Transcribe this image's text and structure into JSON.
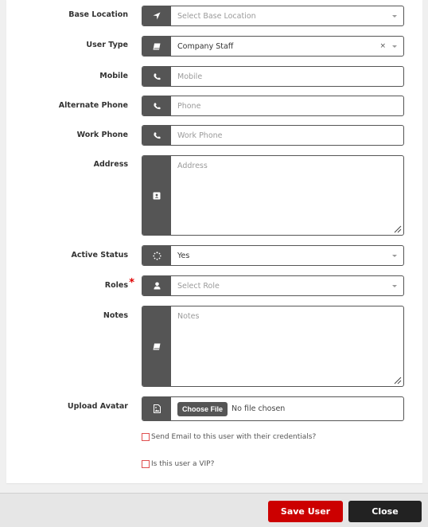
{
  "form": {
    "fields": [
      {
        "label": "Base Location",
        "type": "select",
        "icon": "location-arrow-icon",
        "placeholder": "Select Base Location",
        "value": ""
      },
      {
        "label": "User Type",
        "type": "select",
        "icon": "book-icon",
        "placeholder": "",
        "value": "Company Staff",
        "clearable": true,
        "clear_glyph": "×"
      },
      {
        "label": "Mobile",
        "type": "text",
        "icon": "phone-icon",
        "placeholder": "Mobile",
        "value": ""
      },
      {
        "label": "Alternate Phone",
        "type": "text",
        "icon": "phone-icon",
        "placeholder": "Phone",
        "value": ""
      },
      {
        "label": "Work Phone",
        "type": "text",
        "icon": "phone-icon",
        "placeholder": "Work Phone",
        "value": ""
      },
      {
        "label": "Address",
        "type": "textarea",
        "icon": "address-card-icon",
        "placeholder": "Address",
        "value": ""
      },
      {
        "label": "Active Status",
        "type": "select",
        "icon": "spinner-icon",
        "placeholder": "",
        "value": "Yes"
      },
      {
        "label": "Roles",
        "type": "select",
        "icon": "user-icon",
        "placeholder": "Select Role",
        "value": "",
        "required": true,
        "required_marker": "*"
      },
      {
        "label": "Notes",
        "type": "textarea",
        "icon": "book-icon",
        "placeholder": "Notes",
        "value": ""
      },
      {
        "label": "Upload Avatar",
        "type": "file",
        "icon": "file-image-icon",
        "button_label": "Choose File",
        "status": "No file chosen"
      }
    ],
    "checkboxes": [
      {
        "label": "Send Email to this user with their credentials?",
        "checked": false
      },
      {
        "label": "Is this user a VIP?",
        "checked": false
      }
    ]
  },
  "footer": {
    "save_label": "Save User",
    "close_label": "Close"
  },
  "colors": {
    "accent": "#cc0000",
    "addon": "#555555",
    "close_button": "#222222",
    "checkbox_border": "#e05050"
  }
}
